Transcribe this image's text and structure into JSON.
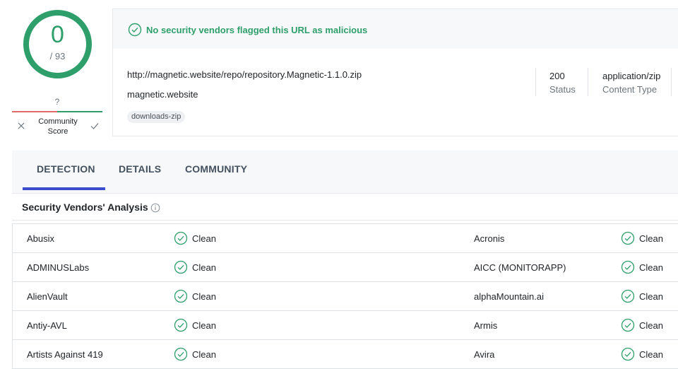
{
  "score": {
    "detections": "0",
    "total": "/ 93",
    "ring_color": "#2e9f6b"
  },
  "community": {
    "unknown": "?",
    "label_line1": "Community",
    "label_line2": "Score"
  },
  "verdict": {
    "text": "No security vendors flagged this URL as malicious",
    "color": "#2e9f6b"
  },
  "target": {
    "url": "http://magnetic.website/repo/repository.Magnetic-1.1.0.zip",
    "domain": "magnetic.website",
    "tag": "downloads-zip",
    "status_value": "200",
    "status_label": "Status",
    "content_type_value": "application/zip",
    "content_type_label": "Content Type"
  },
  "tabs": [
    {
      "label": "DETECTION",
      "active": true
    },
    {
      "label": "DETAILS",
      "active": false
    },
    {
      "label": "COMMUNITY",
      "active": false
    }
  ],
  "section": {
    "title": "Security Vendors' Analysis"
  },
  "vendors": [
    {
      "left_name": "Abusix",
      "left_result": "Clean",
      "right_name": "Acronis",
      "right_result": "Clean"
    },
    {
      "left_name": "ADMINUSLabs",
      "left_result": "Clean",
      "right_name": "AICC (MONITORAPP)",
      "right_result": "Clean"
    },
    {
      "left_name": "AlienVault",
      "left_result": "Clean",
      "right_name": "alphaMountain.ai",
      "right_result": "Clean"
    },
    {
      "left_name": "Antiy-AVL",
      "left_result": "Clean",
      "right_name": "Armis",
      "right_result": "Clean"
    },
    {
      "left_name": "Artists Against 419",
      "left_result": "Clean",
      "right_name": "Avira",
      "right_result": "Clean"
    }
  ],
  "icons": {
    "clean": "check-circle-icon",
    "verdict": "check-circle-icon",
    "info": "info-circle-icon",
    "vote_bad": "close-icon",
    "vote_good": "check-icon"
  }
}
